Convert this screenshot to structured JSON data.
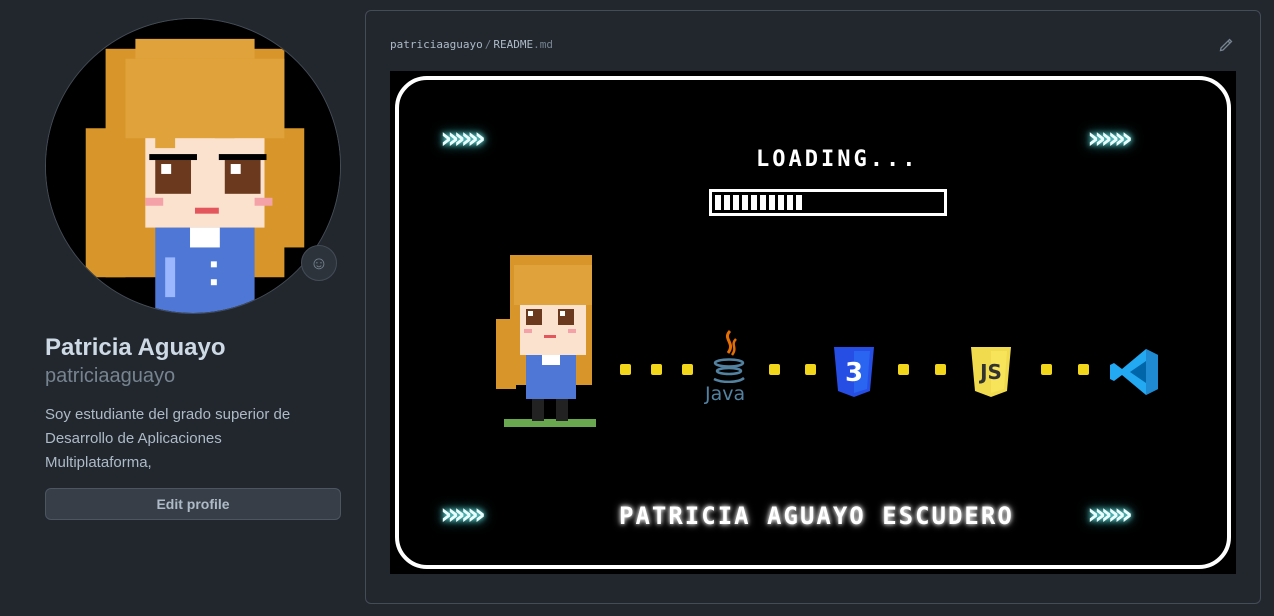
{
  "profile": {
    "fullname": "Patricia Aguayo",
    "username": "patriciaaguayo",
    "bio": "Soy estudiante del grado superior de Desarrollo de Aplicaciones Multiplataforma,",
    "edit_label": "Edit profile"
  },
  "readme": {
    "owner": "patriciaaguayo",
    "separator": "/",
    "file_name": "README",
    "file_ext": ".md",
    "banner": {
      "arrows": "»»»",
      "loading_text": "LOADING...",
      "progress": 0.55,
      "java_label": "Java",
      "css_label": "3",
      "js_label": "JS",
      "footer_name": "PATRICIA AGUAYO ESCUDERO"
    }
  },
  "colors": {
    "background": "#22272e",
    "dot": "#f2d61a",
    "css_blue": "#264de4",
    "js_yellow": "#f0db4f",
    "vscode_blue": "#23a9f2"
  },
  "icons": [
    "smiley-icon",
    "pencil-icon",
    "java-icon",
    "css3-icon",
    "js-icon",
    "vscode-icon"
  ]
}
